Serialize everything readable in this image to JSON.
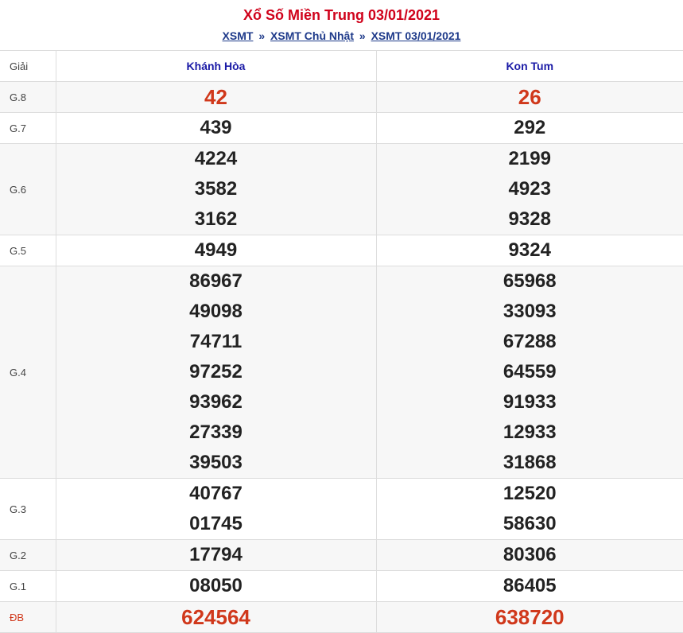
{
  "header": {
    "title": "Xổ Số Miền Trung 03/01/2021",
    "breadcrumb": [
      "XSMT",
      "XSMT Chủ Nhật",
      "XSMT 03/01/2021"
    ],
    "separator": "»"
  },
  "table": {
    "col_label": "Giải",
    "provinces": [
      "Khánh Hòa",
      "Kon Tum"
    ],
    "rows": [
      {
        "label": "G.8",
        "p1": [
          "42"
        ],
        "p2": [
          "26"
        ]
      },
      {
        "label": "G.7",
        "p1": [
          "439"
        ],
        "p2": [
          "292"
        ]
      },
      {
        "label": "G.6",
        "p1": [
          "4224",
          "3582",
          "3162"
        ],
        "p2": [
          "2199",
          "4923",
          "9328"
        ]
      },
      {
        "label": "G.5",
        "p1": [
          "4949"
        ],
        "p2": [
          "9324"
        ]
      },
      {
        "label": "G.4",
        "p1": [
          "86967",
          "49098",
          "74711",
          "97252",
          "93962",
          "27339",
          "39503"
        ],
        "p2": [
          "65968",
          "33093",
          "67288",
          "64559",
          "91933",
          "12933",
          "31868"
        ]
      },
      {
        "label": "G.3",
        "p1": [
          "40767",
          "01745"
        ],
        "p2": [
          "12520",
          "58630"
        ]
      },
      {
        "label": "G.2",
        "p1": [
          "17794"
        ],
        "p2": [
          "80306"
        ]
      },
      {
        "label": "G.1",
        "p1": [
          "08050"
        ],
        "p2": [
          "86405"
        ]
      },
      {
        "label": "ĐB",
        "p1": [
          "624564"
        ],
        "p2": [
          "638720"
        ]
      }
    ]
  },
  "colors": {
    "title": "#d0021b",
    "highlight": "#d0381b",
    "province": "#1a1aa6",
    "link": "#1e3a8a"
  }
}
